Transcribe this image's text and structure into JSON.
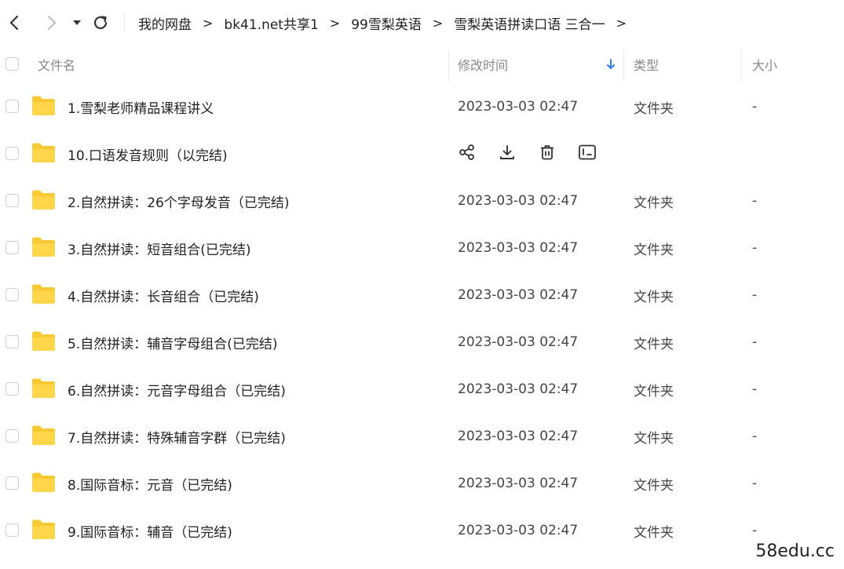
{
  "breadcrumb": [
    {
      "label": "我的网盘"
    },
    {
      "label": "bk41.net共享1"
    },
    {
      "label": "99雪梨英语"
    },
    {
      "label": "雪梨英语拼读口语 三合一"
    }
  ],
  "breadcrumb_separator": ">",
  "columns": {
    "name": "文件名",
    "modified": "修改时间",
    "type": "类型",
    "size": "大小"
  },
  "sort": {
    "column": "modified",
    "direction": "descending",
    "icon": "arrow-down-icon",
    "color": "#2f7ff5"
  },
  "folder_color": "#f9c933",
  "files": [
    {
      "name": "1.雪梨老师精品课程讲义",
      "modified": "2023-03-03 02:47",
      "type": "文件夹",
      "size": "-"
    },
    {
      "name": "10.口语发音规则（以完结)",
      "modified": "",
      "type": "",
      "size": "",
      "hovered": true
    },
    {
      "name": "2.自然拼读：26个字母发音（已完结)",
      "modified": "2023-03-03 02:47",
      "type": "文件夹",
      "size": "-"
    },
    {
      "name": "3.自然拼读：短音组合(已完结)",
      "modified": "2023-03-03 02:47",
      "type": "文件夹",
      "size": "-"
    },
    {
      "name": "4.自然拼读：长音组合（已完结)",
      "modified": "2023-03-03 02:47",
      "type": "文件夹",
      "size": "-"
    },
    {
      "name": "5.自然拼读：辅音字母组合(已完结)",
      "modified": "2023-03-03 02:47",
      "type": "文件夹",
      "size": "-"
    },
    {
      "name": "6.自然拼读：元音字母组合（已完结)",
      "modified": "2023-03-03 02:47",
      "type": "文件夹",
      "size": "-"
    },
    {
      "name": "7.自然拼读：特殊辅音字群（已完结)",
      "modified": "2023-03-03 02:47",
      "type": "文件夹",
      "size": "-"
    },
    {
      "name": "8.国际音标：元音（已完结)",
      "modified": "2023-03-03 02:47",
      "type": "文件夹",
      "size": "-"
    },
    {
      "name": "9.国际音标：辅音（已完结)",
      "modified": "2023-03-03 02:47",
      "type": "文件夹",
      "size": "-"
    }
  ],
  "row_actions": [
    "share-icon",
    "download-icon",
    "delete-icon",
    "rename-icon"
  ],
  "watermark": "58edu.cc"
}
